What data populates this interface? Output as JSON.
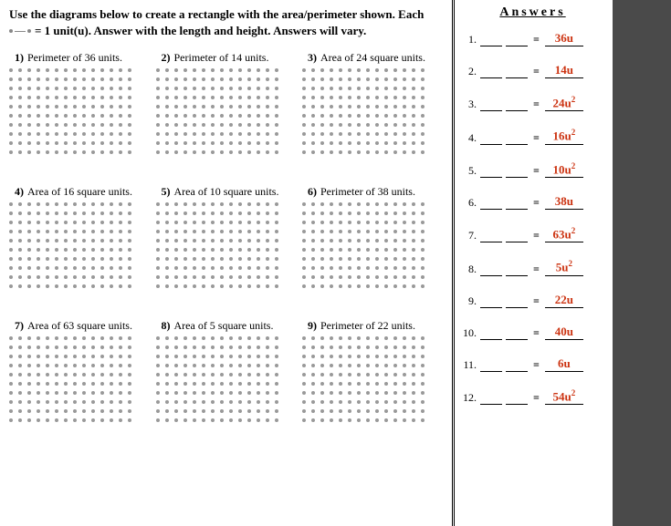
{
  "instructions": {
    "line1": "Use the diagrams below to create a rectangle with the area/perimeter shown. Each",
    "line2_suffix": " = 1 unit(u). Answer with the length and height. Answers will vary."
  },
  "problems": [
    {
      "num": "1)",
      "text": "Perimeter of 36 units."
    },
    {
      "num": "2)",
      "text": "Perimeter of 14 units."
    },
    {
      "num": "3)",
      "text": "Area of 24 square units."
    },
    {
      "num": "4)",
      "text": "Area of 16 square units."
    },
    {
      "num": "5)",
      "text": "Area of 10 square units."
    },
    {
      "num": "6)",
      "text": "Perimeter of 38 units."
    },
    {
      "num": "7)",
      "text": "Area of 63 square units."
    },
    {
      "num": "8)",
      "text": "Area of 5 square units."
    },
    {
      "num": "9)",
      "text": "Perimeter of 22 units."
    }
  ],
  "answers_title": "Answers",
  "answers": [
    {
      "num": "1.",
      "value": "36u",
      "squared": false
    },
    {
      "num": "2.",
      "value": "14u",
      "squared": false
    },
    {
      "num": "3.",
      "value": "24u",
      "squared": true
    },
    {
      "num": "4.",
      "value": "16u",
      "squared": true
    },
    {
      "num": "5.",
      "value": "10u",
      "squared": true
    },
    {
      "num": "6.",
      "value": "38u",
      "squared": false
    },
    {
      "num": "7.",
      "value": "63u",
      "squared": true
    },
    {
      "num": "8.",
      "value": "5u",
      "squared": true
    },
    {
      "num": "9.",
      "value": "22u",
      "squared": false
    },
    {
      "num": "10.",
      "value": "40u",
      "squared": false
    },
    {
      "num": "11.",
      "value": "6u",
      "squared": false
    },
    {
      "num": "12.",
      "value": "54u",
      "squared": true
    }
  ],
  "grid": {
    "rows": 10,
    "cols": 14
  }
}
